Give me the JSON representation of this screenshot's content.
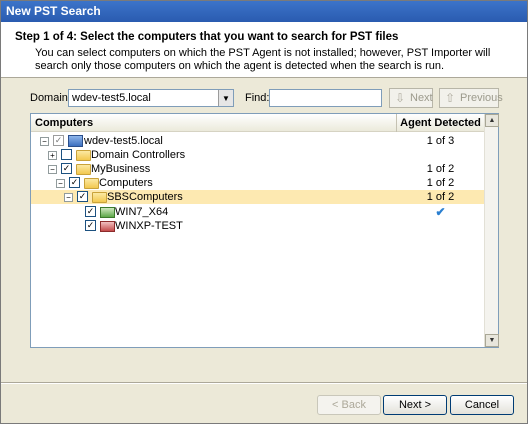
{
  "window": {
    "title": "New PST Search"
  },
  "header": {
    "step": "Step 1 of 4: Select the computers that you want to search for PST files",
    "description": "You can select computers on which the PST Agent is not installed; however, PST Importer will search only those computers on which the agent is detected when the search is run."
  },
  "controls": {
    "domain_label": "Domain:",
    "domain_value": "wdev-test5.local",
    "find_label": "Find:",
    "find_value": "",
    "next_label": "Next",
    "previous_label": "Previous"
  },
  "tree": {
    "columns": [
      "Computers",
      "Agent Detected"
    ],
    "rows": [
      {
        "name": "wdev-test5.local",
        "agent": "1 of 3",
        "icon": "domain-icon",
        "checked": "partial",
        "expanded": true
      },
      {
        "name": "Domain Controllers",
        "agent": "",
        "icon": "folder-icon",
        "checked": "none",
        "expanded": false
      },
      {
        "name": "MyBusiness",
        "agent": "1 of 2",
        "icon": "folder-icon",
        "checked": "checked",
        "expanded": true
      },
      {
        "name": "Computers",
        "agent": "1 of 2",
        "icon": "folder-icon",
        "checked": "checked",
        "expanded": true
      },
      {
        "name": "SBSComputers",
        "agent": "1 of 2",
        "icon": "folder-icon",
        "checked": "checked",
        "expanded": true,
        "selected": true
      },
      {
        "name": "WIN7_X64",
        "agent": "✔",
        "icon": "computer-agent-icon",
        "checked": "checked"
      },
      {
        "name": "WINXP-TEST",
        "agent": "",
        "icon": "computer-no-agent-icon",
        "checked": "checked"
      }
    ]
  },
  "footer": {
    "back_label": "< Back",
    "next_label": "Next >",
    "cancel_label": "Cancel"
  }
}
